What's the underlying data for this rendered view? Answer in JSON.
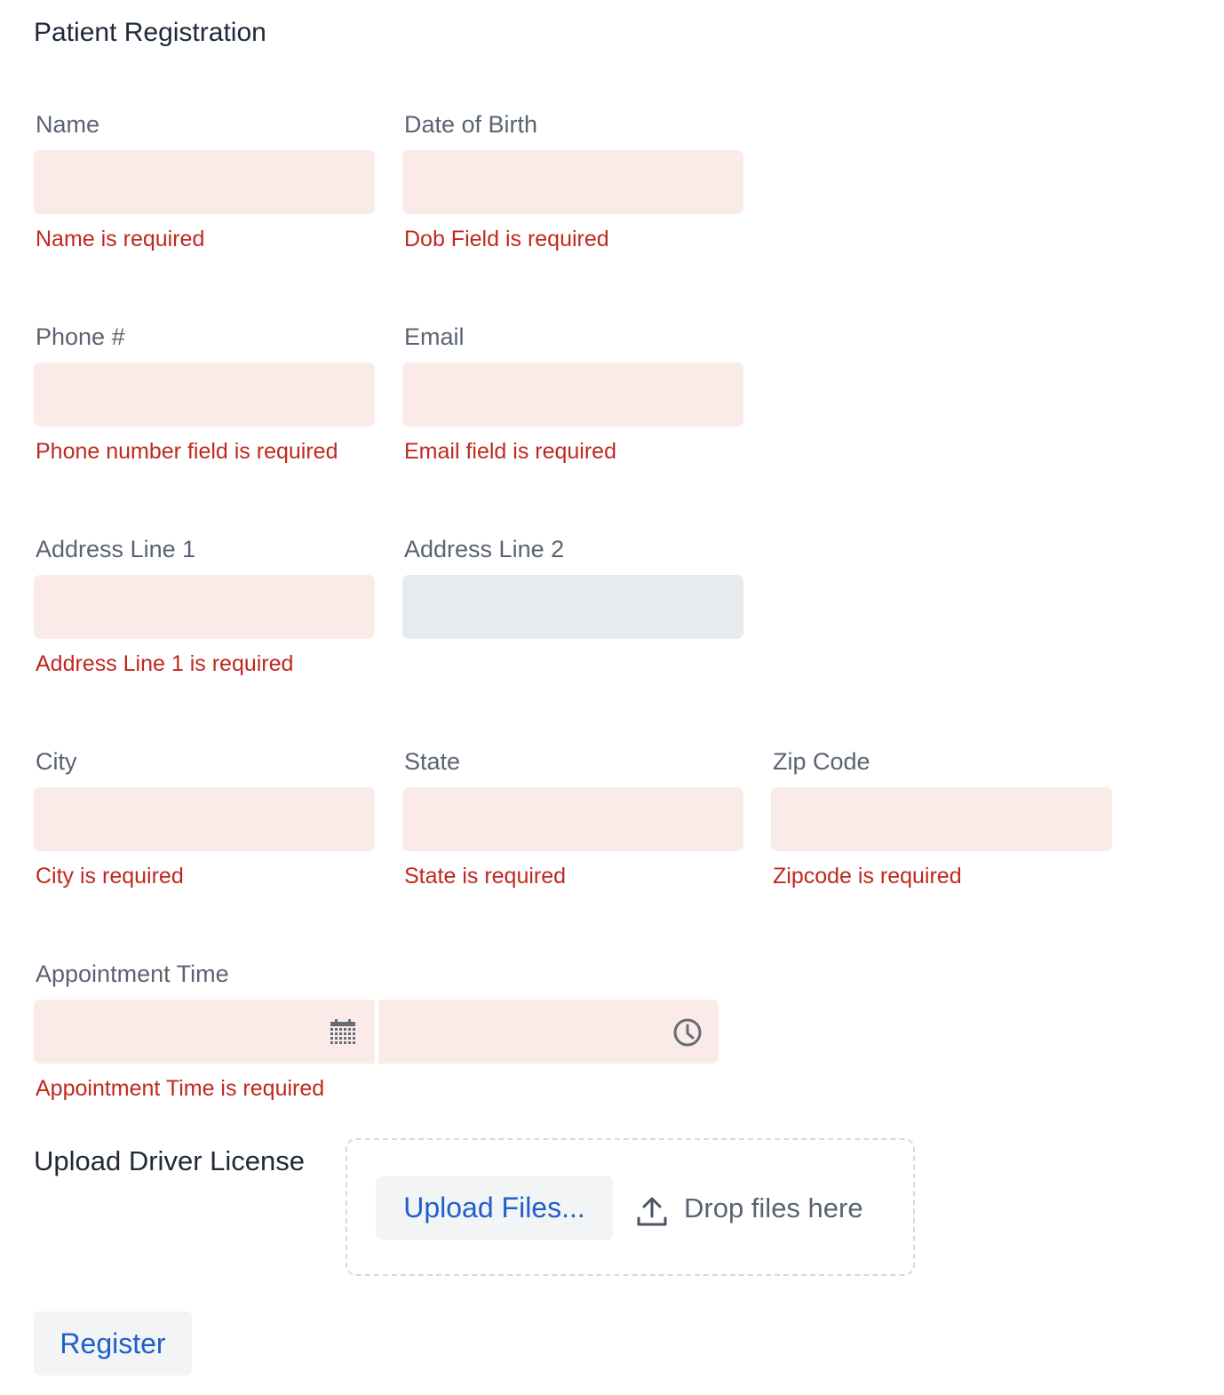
{
  "form": {
    "title": "Patient Registration",
    "fields": {
      "name": {
        "label": "Name",
        "value": "",
        "error": "Name is required"
      },
      "dob": {
        "label": "Date of Birth",
        "value": "",
        "error": "Dob Field is required"
      },
      "phone": {
        "label": "Phone #",
        "value": "",
        "error": "Phone number field is required"
      },
      "email": {
        "label": "Email",
        "value": "",
        "error": "Email field is required"
      },
      "address1": {
        "label": "Address Line 1",
        "value": "",
        "error": "Address Line 1 is required"
      },
      "address2": {
        "label": "Address Line 2",
        "value": ""
      },
      "city": {
        "label": "City",
        "value": "",
        "error": "City is required"
      },
      "state": {
        "label": "State",
        "value": "",
        "error": "State is required"
      },
      "zip": {
        "label": "Zip Code",
        "value": "",
        "error": "Zipcode is required"
      },
      "appointment": {
        "label": "Appointment Time",
        "date_value": "",
        "time_value": "",
        "error": "Appointment Time is required",
        "date_icon": "calendar-icon",
        "time_icon": "clock-icon"
      }
    },
    "upload": {
      "label": "Upload Driver License",
      "button_label": "Upload Files...",
      "drop_text": "Drop files here",
      "icon": "upload-icon"
    },
    "submit_label": "Register"
  },
  "colors": {
    "error_text": "#c0281f",
    "invalid_input_bg": "#fbebe8",
    "neutral_input_bg": "#e8ebee",
    "link_blue": "#1f5fc9",
    "label_gray": "#5b6372",
    "title_text": "#1f2937"
  }
}
